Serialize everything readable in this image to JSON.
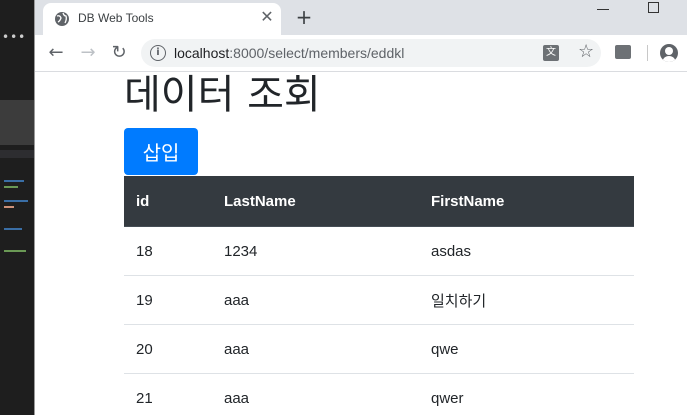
{
  "browser": {
    "tab_title": "DB Web Tools",
    "url_host": "localhost",
    "url_rest": ":8000/select/members/eddkl"
  },
  "page": {
    "title": "데이터 조회",
    "insert_button": "삽입"
  },
  "table": {
    "columns": [
      "id",
      "LastName",
      "FirstName"
    ],
    "rows": [
      [
        "18",
        "1234",
        "asdas"
      ],
      [
        "19",
        "aaa",
        "일치하기"
      ],
      [
        "20",
        "aaa",
        "qwe"
      ],
      [
        "21",
        "aaa",
        "qwer"
      ]
    ]
  },
  "colors": {
    "primary": "#007bff",
    "table_header": "#343a40"
  }
}
